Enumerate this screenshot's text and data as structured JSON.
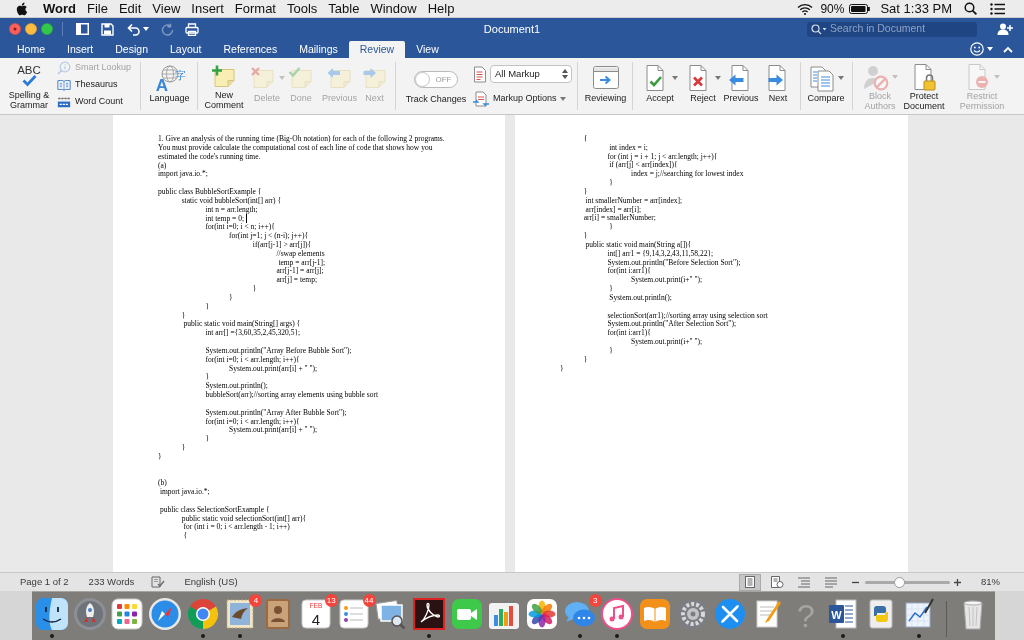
{
  "menu_bar": {
    "app": "Word",
    "menus": [
      "File",
      "Edit",
      "View",
      "Insert",
      "Format",
      "Tools",
      "Table",
      "Window",
      "Help"
    ],
    "battery": "90%",
    "clock": "Sat 1:33 PM"
  },
  "title_bar": {
    "quick_access": [
      {
        "disabled": false
      },
      {
        "disabled": false
      },
      {
        "disabled": false
      },
      {
        "disabled": true
      },
      {
        "disabled": false
      }
    ],
    "title": "Document1",
    "search": {
      "placeholder": "Search in Document"
    }
  },
  "tabs": [
    {
      "label": "Home",
      "selected": false
    },
    {
      "label": "Insert",
      "selected": false
    },
    {
      "label": "Design",
      "selected": false
    },
    {
      "label": "Layout",
      "selected": false
    },
    {
      "label": "References",
      "selected": false
    },
    {
      "label": "Mailings",
      "selected": false
    },
    {
      "label": "Review",
      "selected": true
    },
    {
      "label": "View",
      "selected": false
    }
  ],
  "ribbon": {
    "groups": [
      {
        "items": [
          {
            "kind": "large",
            "label": "Spelling &\nGrammar",
            "icon_text": [
              "ABC"
            ],
            "disabled": false,
            "dropdown": false
          },
          {
            "kind": "small",
            "label": "Smart Lookup",
            "disabled": true,
            "dropdown": false
          },
          {
            "kind": "small",
            "label": "Thesaurus",
            "disabled": false,
            "dropdown": false
          },
          {
            "kind": "small",
            "label": "Word Count",
            "disabled": false,
            "dropdown": false
          }
        ]
      },
      {
        "items": [
          {
            "kind": "large",
            "label": "Language",
            "icon_text": [
              "A",
              "字"
            ],
            "disabled": false,
            "dropdown": false
          }
        ]
      },
      {
        "items": [
          {
            "kind": "large",
            "label": "New\nComment",
            "disabled": false,
            "dropdown": false
          },
          {
            "kind": "large",
            "label": "Delete",
            "disabled": true,
            "dropdown": true
          },
          {
            "kind": "large",
            "label": "Done",
            "disabled": true,
            "dropdown": false
          },
          {
            "kind": "large",
            "label": "Previous",
            "disabled": true,
            "dropdown": false
          },
          {
            "kind": "large",
            "label": "Next",
            "disabled": true,
            "dropdown": false
          }
        ]
      },
      {
        "items": [
          {
            "kind": "toggle",
            "label": "Track Changes",
            "state_label": "OFF",
            "on": false
          },
          {
            "kind": "select",
            "value": "All Markup"
          },
          {
            "kind": "small",
            "label": "Markup Options",
            "disabled": false,
            "dropdown": true
          }
        ]
      },
      {
        "items": [
          {
            "kind": "large",
            "label": "Reviewing",
            "disabled": false,
            "dropdown": false
          }
        ]
      },
      {
        "items": [
          {
            "kind": "large",
            "label": "Accept",
            "disabled": false,
            "dropdown": true
          },
          {
            "kind": "large",
            "label": "Reject",
            "disabled": false,
            "dropdown": true
          },
          {
            "kind": "large",
            "label": "Previous",
            "disabled": false,
            "dropdown": false
          },
          {
            "kind": "large",
            "label": "Next",
            "disabled": false,
            "dropdown": false
          }
        ]
      },
      {
        "items": [
          {
            "kind": "large",
            "label": "Compare",
            "disabled": false,
            "dropdown": true
          }
        ]
      },
      {
        "items": [
          {
            "kind": "large",
            "label": "Block\nAuthors",
            "disabled": true,
            "dropdown": true
          },
          {
            "kind": "large",
            "label": "Protect\nDocument",
            "disabled": false,
            "dropdown": false
          },
          {
            "kind": "large",
            "label": "Restrict\nPermission",
            "disabled": true,
            "dropdown": true
          }
        ]
      }
    ]
  },
  "pages": [
    {
      "lines": [
        {
          "kind": "para",
          "text": "1. Give an analysis of the running time (Big-Oh notation) for each of the following 2 programs. You must provide calculate the computational cost of each line of code that shows how you estimated the code's running time."
        },
        {
          "kind": "code",
          "text": "(a)"
        },
        {
          "kind": "code",
          "text": "import java.io.*;"
        },
        {
          "kind": "blank"
        },
        {
          "kind": "code",
          "text": "public class BubbleSortExample {"
        },
        {
          "kind": "code",
          "text": "\tstatic void bubbleSort(int[] arr) {"
        },
        {
          "kind": "code",
          "text": "\t\tint n = arr.length;"
        },
        {
          "kind": "code",
          "text": "\t\tint temp = 0;",
          "caret": true
        },
        {
          "kind": "code",
          "text": "\t\tfor(int i=0; i < n; i++){"
        },
        {
          "kind": "code",
          "text": "\t\t\tfor(int j=1; j < (n-i); j++){"
        },
        {
          "kind": "code",
          "text": "\t\t\t\tif(arr[j-1] > arr[j]){"
        },
        {
          "kind": "code",
          "text": "\t\t\t\t\t//swap elements"
        },
        {
          "kind": "code",
          "text": "\t\t\t\t\t temp = arr[j-1];"
        },
        {
          "kind": "code",
          "text": "\t\t\t\t\tarr[j-1] = arr[j];"
        },
        {
          "kind": "code",
          "text": "\t\t\t\t\tarr[j] = temp;"
        },
        {
          "kind": "code",
          "text": "\t\t\t\t}"
        },
        {
          "kind": "code",
          "text": "\t\t\t}"
        },
        {
          "kind": "code",
          "text": "\t\t}"
        },
        {
          "kind": "code",
          "text": "\t}"
        },
        {
          "kind": "code",
          "text": "\t public static void main(String[] args) {"
        },
        {
          "kind": "code",
          "text": "\t\tint arr[] ={3,60,35,2,45,320,5};"
        },
        {
          "kind": "blank"
        },
        {
          "kind": "code",
          "text": "\t\tSystem.out.println(\"Array Before Bubble Sort\");"
        },
        {
          "kind": "code",
          "text": "\t\tfor(int i=0; i < arr.length; i++){"
        },
        {
          "kind": "code",
          "text": "\t\t\tSystem.out.print(arr[i] + \" \");"
        },
        {
          "kind": "code",
          "text": "\t\t}"
        },
        {
          "kind": "code",
          "text": "\t\tSystem.out.println();"
        },
        {
          "kind": "code",
          "text": "\t\tbubbleSort(arr);//sorting array elements using bubble sort"
        },
        {
          "kind": "blank"
        },
        {
          "kind": "code",
          "text": "\t\tSystem.out.println(\"Array After Bubble Sort\");"
        },
        {
          "kind": "code",
          "text": "\t\tfor(int i=0; i < arr.length; i++){"
        },
        {
          "kind": "code",
          "text": "\t\t\tSystem.out.print(arr[i] + \" \");"
        },
        {
          "kind": "code",
          "text": "\t\t}"
        },
        {
          "kind": "code",
          "text": "\t}"
        },
        {
          "kind": "code",
          "text": "}"
        },
        {
          "kind": "blank"
        },
        {
          "kind": "blank"
        },
        {
          "kind": "code",
          "text": "(b)"
        },
        {
          "kind": "code",
          "text": " import java.io.*;"
        },
        {
          "kind": "blank"
        },
        {
          "kind": "code",
          "text": " public class SelectionSortExample {"
        },
        {
          "kind": "code",
          "text": "\tpublic static void selectionSort(int[] arr){"
        },
        {
          "kind": "code",
          "text": "\t for (int i = 0; i < arr.length - 1; i++)"
        },
        {
          "kind": "code",
          "text": "\t {"
        }
      ]
    },
    {
      "lines": [
        {
          "kind": "code",
          "text": "\t{"
        },
        {
          "kind": "code",
          "text": "\t\t int index = i;"
        },
        {
          "kind": "code",
          "text": "\t\tfor (int j = i + 1; j < arr.length; j++){"
        },
        {
          "kind": "code",
          "text": "\t\t if (arr[j] < arr[index]){"
        },
        {
          "kind": "code",
          "text": "\t\t\tindex = j;//searching for lowest index"
        },
        {
          "kind": "code",
          "text": "\t\t }"
        },
        {
          "kind": "code",
          "text": "\t}"
        },
        {
          "kind": "code",
          "text": "\t int smallerNumber = arr[index];"
        },
        {
          "kind": "code",
          "text": "\t arr[index] = arr[i];"
        },
        {
          "kind": "code",
          "text": "\tarr[i] = smallerNumber;"
        },
        {
          "kind": "code",
          "text": "\t\t }"
        },
        {
          "kind": "code",
          "text": "\t}"
        },
        {
          "kind": "code",
          "text": "\t public static void main(String a[]){"
        },
        {
          "kind": "code",
          "text": "\t\tint[] arr1 = {9,14,3,2,43,11,58,22};"
        },
        {
          "kind": "code",
          "text": "\t\tSystem.out.println(\"Before Selection Sort\");"
        },
        {
          "kind": "code",
          "text": "\t\tfor(int i:arr1){"
        },
        {
          "kind": "code",
          "text": "\t\t\tSystem.out.print(i+\" \");"
        },
        {
          "kind": "code",
          "text": "\t\t }"
        },
        {
          "kind": "code",
          "text": "\t\t System.out.println();"
        },
        {
          "kind": "blank"
        },
        {
          "kind": "code",
          "text": "\t\tselectionSort(arr1);//sorting array using selection sort"
        },
        {
          "kind": "code",
          "text": "\t\tSystem.out.println(\"After Selection Sort\");"
        },
        {
          "kind": "code",
          "text": "\t\tfor(int i:arr1){"
        },
        {
          "kind": "code",
          "text": "\t\t\tSystem.out.print(i+\" \");"
        },
        {
          "kind": "code",
          "text": "\t\t }"
        },
        {
          "kind": "code",
          "text": "\t}"
        },
        {
          "kind": "code",
          "text": "}"
        }
      ]
    }
  ],
  "status_bar": {
    "page": "Page 1 of 2",
    "words": "233 Words",
    "language": "English (US)",
    "views": [
      {
        "selected": true
      },
      {
        "selected": false
      },
      {
        "selected": false
      },
      {
        "selected": false
      }
    ],
    "zoom": {
      "level": 0.41,
      "reading": "81%"
    }
  },
  "dock": [
    {
      "running": true
    },
    {
      "running": false
    },
    {
      "running": false
    },
    {
      "running": false
    },
    {
      "running": true
    },
    {
      "running": true,
      "badge": "4"
    },
    {
      "running": false
    },
    {
      "running": false,
      "badge": "13",
      "icon_text": [
        "FEB",
        "4"
      ]
    },
    {
      "running": false,
      "badge": "44"
    },
    {
      "running": false
    },
    {
      "running": true
    },
    {
      "running": false
    },
    {
      "running": false
    },
    {
      "running": false
    },
    {
      "running": true,
      "badge": "3"
    },
    {
      "running": true
    },
    {
      "running": false
    },
    {
      "running": false
    },
    {
      "running": false
    },
    {
      "running": false
    },
    {
      "running": false,
      "icon_text": [
        "?"
      ]
    },
    {
      "running": true,
      "icon_text": [
        "W"
      ]
    },
    {
      "running": false
    },
    {
      "running": true
    },
    {
      "running": false
    }
  ]
}
